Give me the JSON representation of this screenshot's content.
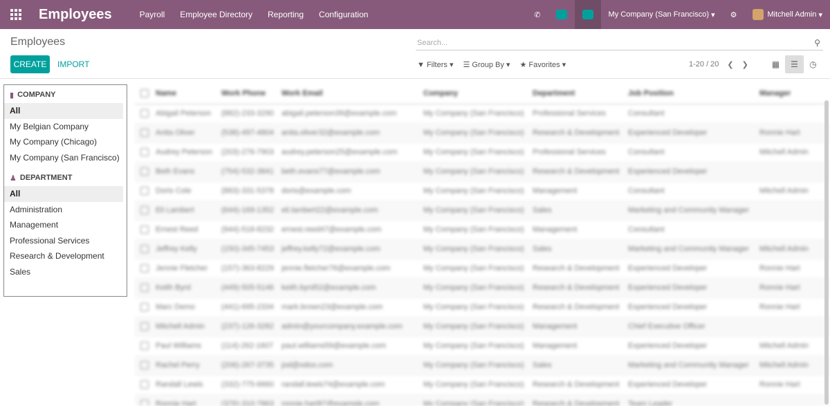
{
  "topbar": {
    "app_name": "Employees",
    "menu": [
      "Payroll",
      "Employee Directory",
      "Reporting",
      "Configuration"
    ],
    "company": "My Company (San Francisco)",
    "user": "Mitchell Admin"
  },
  "control": {
    "breadcrumb": "Employees",
    "create_label": "CREATE",
    "import_label": "IMPORT",
    "search_placeholder": "Search...",
    "filters_label": "Filters",
    "groupby_label": "Group By",
    "favorites_label": "Favorites",
    "pager": "1-20 / 20"
  },
  "sidebar": {
    "company_title": "COMPANY",
    "company_items": [
      "All",
      "My Belgian Company",
      "My Company (Chicago)",
      "My Company (San Francisco)"
    ],
    "department_title": "DEPARTMENT",
    "department_items": [
      "All",
      "Administration",
      "Management",
      "Professional Services",
      "Research & Development",
      "Sales"
    ]
  },
  "table": {
    "columns": [
      "Name",
      "Work Phone",
      "Work Email",
      "Company",
      "Department",
      "Job Position",
      "Manager"
    ],
    "rows": [
      [
        "Abigail Peterson",
        "(882)-233-3290",
        "abigail.peterson39@example.com",
        "My Company (San Francisco)",
        "Professional Services",
        "Consultant",
        ""
      ],
      [
        "Anita Oliver",
        "(538)-497-4804",
        "anita.oliver32@example.com",
        "My Company (San Francisco)",
        "Research & Development",
        "Experienced Developer",
        "Ronnie Hart"
      ],
      [
        "Audrey Peterson",
        "(203)-276-7903",
        "audrey.peterson25@example.com",
        "My Company (San Francisco)",
        "Professional Services",
        "Consultant",
        "Mitchell Admin"
      ],
      [
        "Beth Evans",
        "(754)-532-3841",
        "beth.evans77@example.com",
        "My Company (San Francisco)",
        "Research & Development",
        "Experienced Developer",
        ""
      ],
      [
        "Doris Cole",
        "(883)-331-5378",
        "doris@example.com",
        "My Company (San Francisco)",
        "Management",
        "Consultant",
        "Mitchell Admin"
      ],
      [
        "Eli Lambert",
        "(644)-169-1352",
        "eli.lambert22@example.com",
        "My Company (San Francisco)",
        "Sales",
        "Marketing and Community Manager",
        ""
      ],
      [
        "Ernest Reed",
        "(944)-518-8232",
        "ernest.reed47@example.com",
        "My Company (San Francisco)",
        "Management",
        "Consultant",
        ""
      ],
      [
        "Jeffrey Kelly",
        "(150)-345-7453",
        "jeffrey.kelly72@example.com",
        "My Company (San Francisco)",
        "Sales",
        "Marketing and Community Manager",
        "Mitchell Admin"
      ],
      [
        "Jennie Fletcher",
        "(157)-363-8229",
        "jennie.fletcher76@example.com",
        "My Company (San Francisco)",
        "Research & Development",
        "Experienced Developer",
        "Ronnie Hart"
      ],
      [
        "Keith Byrd",
        "(449)-505-5146",
        "keith.byrd52@example.com",
        "My Company (San Francisco)",
        "Research & Development",
        "Experienced Developer",
        "Ronnie Hart"
      ],
      [
        "Marc Demo",
        "(441)-695-2334",
        "mark.brown23@example.com",
        "My Company (San Francisco)",
        "Research & Development",
        "Experienced Developer",
        "Ronnie Hart"
      ],
      [
        "Mitchell Admin",
        "(237)-126-3282",
        "admin@yourcompany.example.com",
        "My Company (San Francisco)",
        "Management",
        "Chief Executive Officer",
        ""
      ],
      [
        "Paul Williams",
        "(114)-262-1607",
        "paul.williams59@example.com",
        "My Company (San Francisco)",
        "Management",
        "Experienced Developer",
        "Mitchell Admin"
      ],
      [
        "Rachel Perry",
        "(206)-267-3735",
        "jod@odoo.com",
        "My Company (San Francisco)",
        "Sales",
        "Marketing and Community Manager",
        "Mitchell Admin"
      ],
      [
        "Randall Lewis",
        "(332)-775-6660",
        "randall.lewis74@example.com",
        "My Company (San Francisco)",
        "Research & Development",
        "Experienced Developer",
        "Ronnie Hart"
      ],
      [
        "Ronnie Hart",
        "(376)-310-7863",
        "ronnie.hart87@example.com",
        "My Company (San Francisco)",
        "Research & Development",
        "Team Leader",
        ""
      ]
    ]
  }
}
